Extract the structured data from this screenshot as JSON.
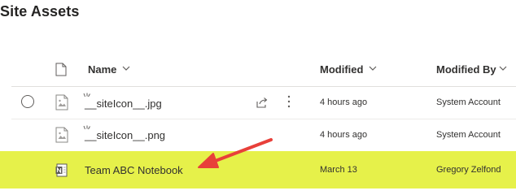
{
  "library": {
    "title": "Site Assets"
  },
  "columns": {
    "name": "Name",
    "modified": "Modified",
    "modified_by": "Modified By"
  },
  "rows": [
    {
      "name": "__siteIcon__.jpg",
      "modified": "4 hours ago",
      "modified_by": "System Account",
      "icon": "image-file-icon",
      "new": true
    },
    {
      "name": "__siteIcon__.png",
      "modified": "4 hours ago",
      "modified_by": "System Account",
      "icon": "image-file-icon",
      "new": true
    },
    {
      "name": "Team ABC Notebook",
      "modified": "March 13",
      "modified_by": "Gregory Zelfond",
      "icon": "onenote-notebook-icon",
      "highlighted": true
    }
  ],
  "colors": {
    "highlight": "#e6f14a",
    "annotation_arrow": "#e8403a"
  }
}
